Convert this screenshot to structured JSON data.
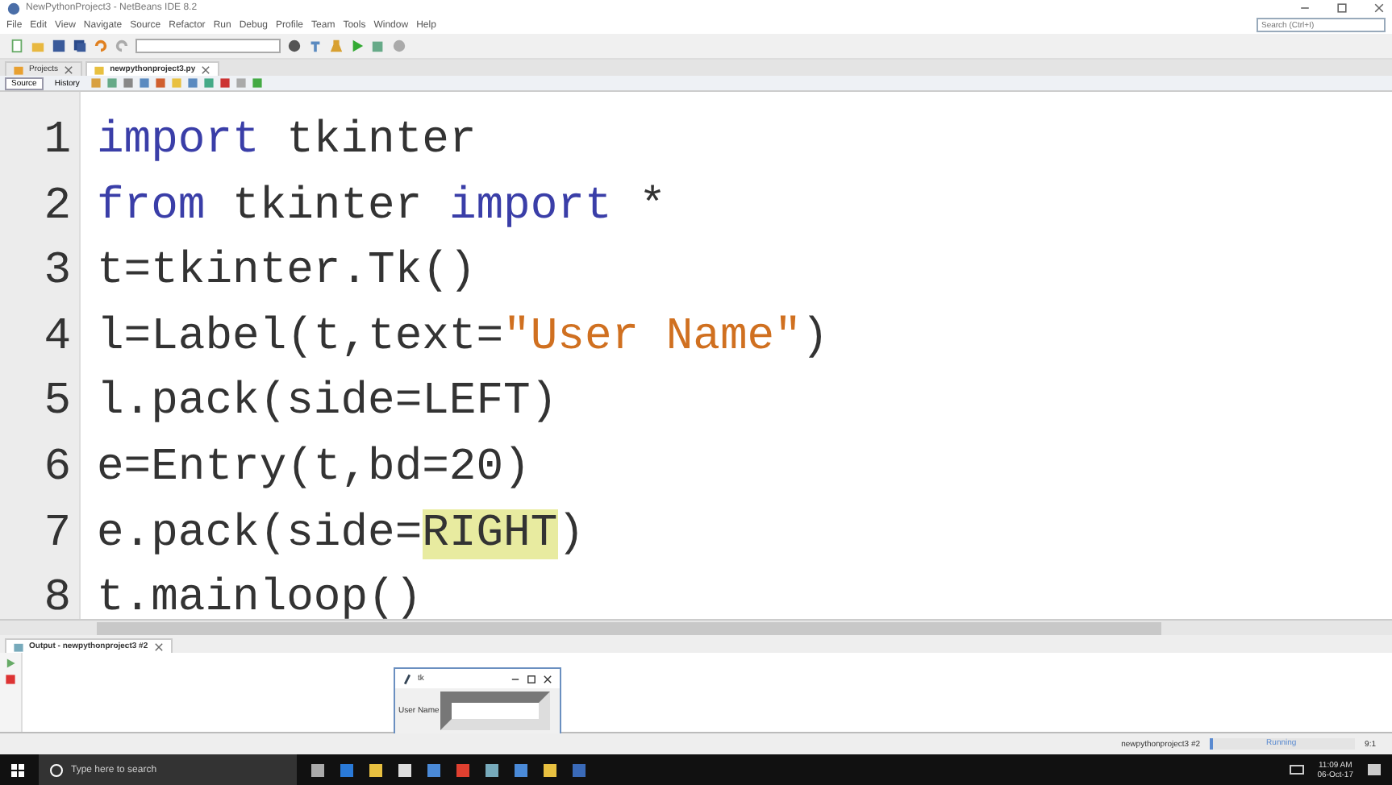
{
  "window": {
    "title": "NewPythonProject3 - NetBeans IDE 8.2"
  },
  "search": {
    "placeholder": "Search (Ctrl+I)"
  },
  "menu": [
    "File",
    "Edit",
    "View",
    "Navigate",
    "Source",
    "Refactor",
    "Run",
    "Debug",
    "Profile",
    "Team",
    "Tools",
    "Window",
    "Help"
  ],
  "editor_tabs": [
    {
      "label": "Projects",
      "selected": false
    },
    {
      "label": "newpythonproject3.py",
      "selected": true
    }
  ],
  "views": [
    {
      "label": "Source",
      "selected": true
    },
    {
      "label": "History",
      "selected": false
    }
  ],
  "code": [
    {
      "number": "1",
      "tokens": [
        {
          "kind": "keyword",
          "text": "import"
        },
        {
          "kind": "plain",
          "text": " tkinter"
        }
      ]
    },
    {
      "number": "2",
      "tokens": [
        {
          "kind": "keyword",
          "text": "from"
        },
        {
          "kind": "plain",
          "text": " tkinter "
        },
        {
          "kind": "keyword",
          "text": "import"
        },
        {
          "kind": "plain",
          "text": " *"
        }
      ]
    },
    {
      "number": "3",
      "tokens": [
        {
          "kind": "plain",
          "text": "t=tkinter.Tk()"
        }
      ]
    },
    {
      "number": "4",
      "tokens": [
        {
          "kind": "plain",
          "text": "l=Label(t,text="
        },
        {
          "kind": "string",
          "text": "\"User Name\""
        },
        {
          "kind": "plain",
          "text": ")"
        }
      ]
    },
    {
      "number": "5",
      "tokens": [
        {
          "kind": "plain",
          "text": "l.pack(side=LEFT)"
        }
      ]
    },
    {
      "number": "6",
      "tokens": [
        {
          "kind": "plain",
          "text": "e=Entry(t,bd=20)"
        }
      ]
    },
    {
      "number": "7",
      "tokens": [
        {
          "kind": "plain",
          "text": "e.pack(side="
        },
        {
          "kind": "highlight",
          "text": "RIGHT"
        },
        {
          "kind": "plain",
          "text": ")"
        }
      ]
    },
    {
      "number": "8",
      "tokens": [
        {
          "kind": "plain",
          "text": "t.mainloop()"
        }
      ]
    }
  ],
  "output": {
    "tab": "Output - newpythonproject3 #2",
    "app_window": {
      "title": "tk",
      "label": "User Name"
    }
  },
  "status_bar": {
    "process": "newpythonproject3 #2",
    "progress": {
      "label": "Running",
      "level": 0.02
    },
    "position": "9:1"
  },
  "taskbar": {
    "search_placeholder": "Type here to search",
    "time": "11:09 AM",
    "date": "06-Oct-17"
  }
}
